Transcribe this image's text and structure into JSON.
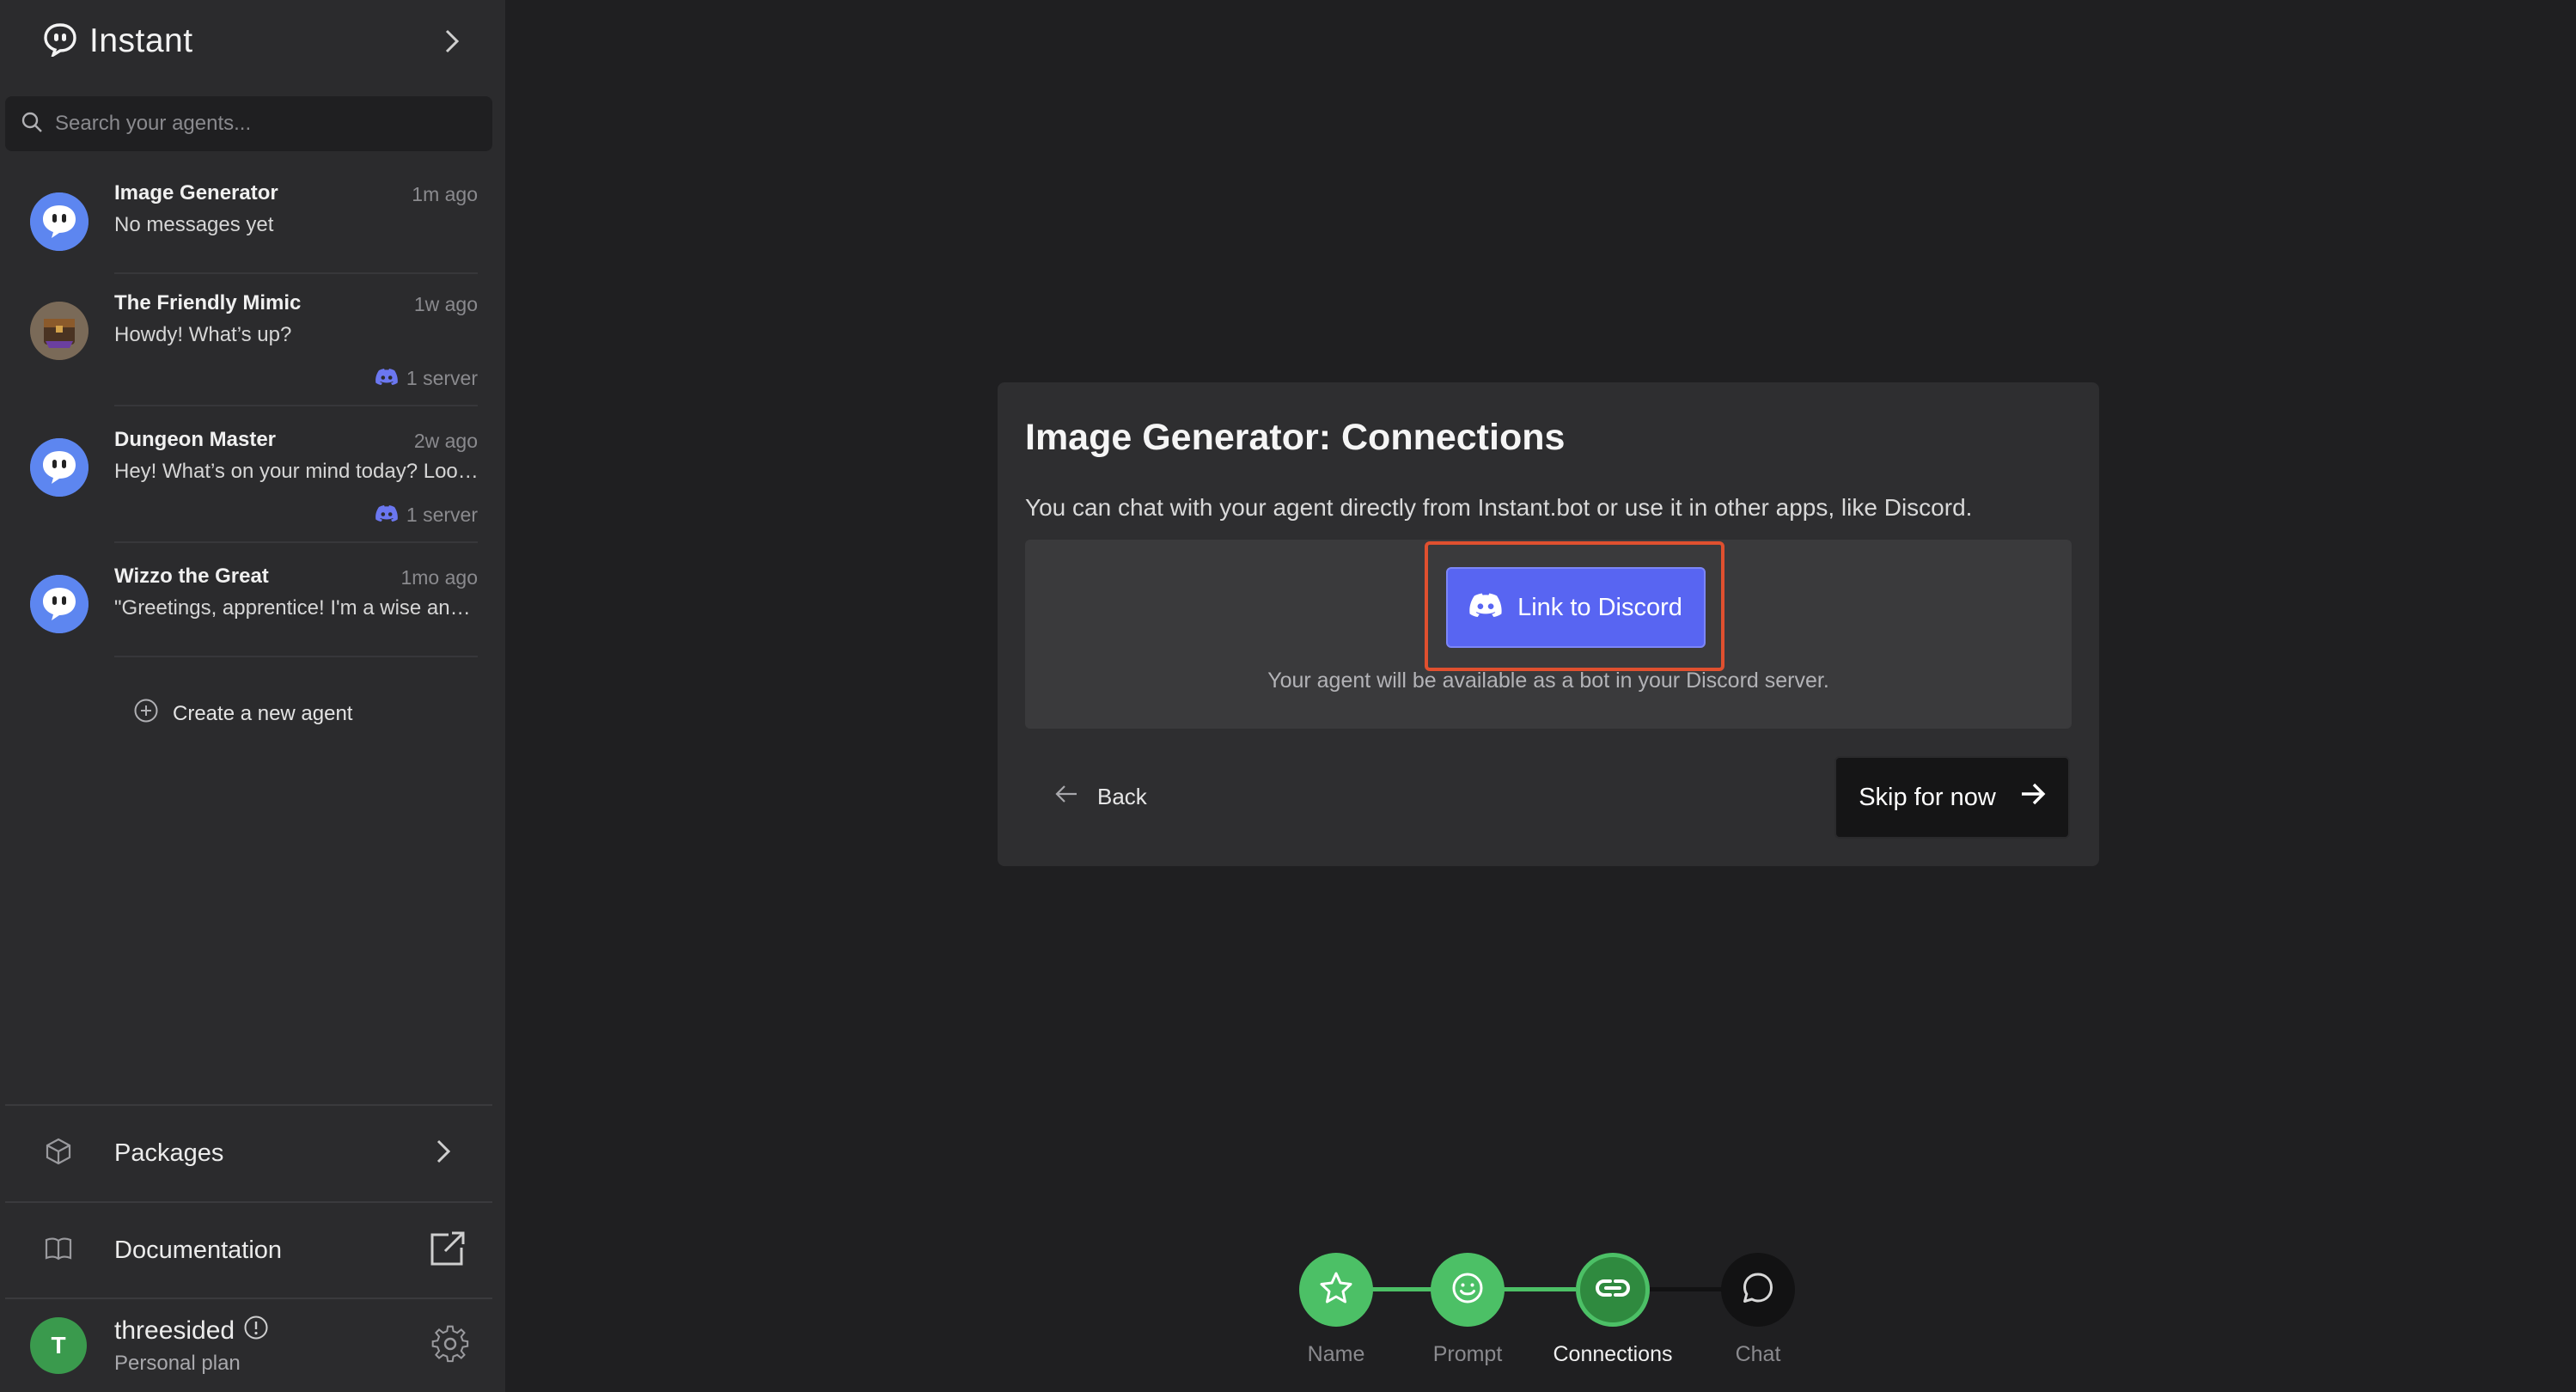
{
  "app": {
    "brand": "Instant"
  },
  "search": {
    "placeholder": "Search your agents..."
  },
  "agents": [
    {
      "name": "Image Generator",
      "time": "1m ago",
      "preview": "No messages yet",
      "servers": ""
    },
    {
      "name": "The Friendly Mimic",
      "time": "1w ago",
      "preview": "Howdy! What’s up?",
      "servers": "1 server"
    },
    {
      "name": "Dungeon Master",
      "time": "2w ago",
      "preview": "Hey! What’s on your mind today? Loo…",
      "servers": "1 server"
    },
    {
      "name": "Wizzo the Great",
      "time": "1mo ago",
      "preview": "\"Greetings, apprentice! I'm a wise an…",
      "servers": ""
    }
  ],
  "create_agent_label": "Create a new agent",
  "menu": {
    "packages": "Packages",
    "documentation": "Documentation"
  },
  "user": {
    "initial": "T",
    "name": "threesided",
    "plan": "Personal plan"
  },
  "dialog": {
    "title": "Image Generator: Connections",
    "description": "You can chat with your agent directly from Instant.bot or use it in other apps, like Discord.",
    "discord_button": "Link to Discord",
    "discord_note": "Your agent will be available as a bot in your Discord server.",
    "back": "Back",
    "skip": "Skip for now"
  },
  "steps": [
    {
      "label": "Name",
      "status": "complete"
    },
    {
      "label": "Prompt",
      "status": "complete"
    },
    {
      "label": "Connections",
      "status": "current"
    },
    {
      "label": "Chat",
      "status": "upcoming"
    }
  ],
  "colors": {
    "discord": "#5865f2",
    "step_green": "#4cc066",
    "highlight": "#e0502f"
  }
}
